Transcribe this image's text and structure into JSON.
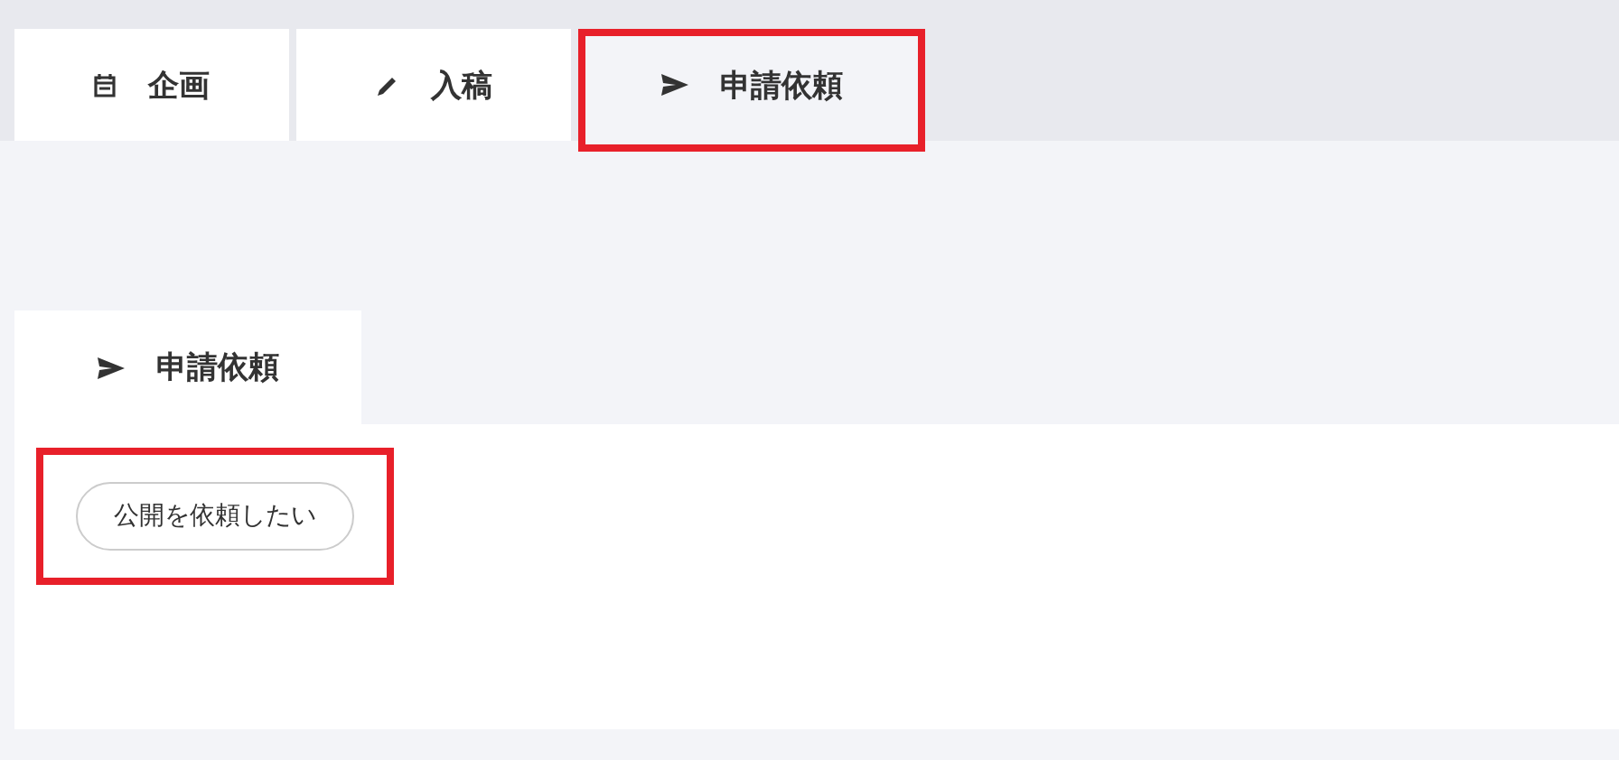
{
  "tabs": [
    {
      "label": "企画",
      "kind": "calendar",
      "selected": false,
      "highlighted": false
    },
    {
      "label": "入稿",
      "kind": "pencil",
      "selected": false,
      "highlighted": false
    },
    {
      "label": "申請依頼",
      "kind": "send",
      "selected": true,
      "highlighted": true
    }
  ],
  "section": {
    "tab": {
      "label": "申請依頼",
      "kind": "send",
      "selected": true
    },
    "button": {
      "label": "公開を依頼したい",
      "highlighted": true
    }
  }
}
